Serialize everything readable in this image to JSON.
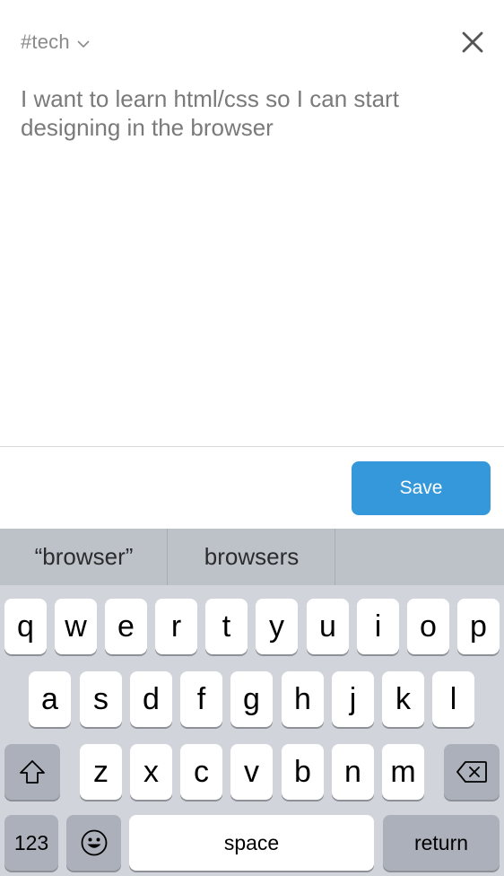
{
  "header": {
    "channel": "#tech",
    "chevron_icon": "chevron-down-icon",
    "close_icon": "close-icon"
  },
  "compose": {
    "text": "I want to learn html/css so I can start designing in the browser"
  },
  "actions": {
    "save_label": "Save",
    "save_color": "#3498db"
  },
  "suggestions": [
    "“browser”",
    "browsers",
    ""
  ],
  "keyboard": {
    "row1": [
      "q",
      "w",
      "e",
      "r",
      "t",
      "y",
      "u",
      "i",
      "o",
      "p"
    ],
    "row2": [
      "a",
      "s",
      "d",
      "f",
      "g",
      "h",
      "j",
      "k",
      "l"
    ],
    "row3": [
      "z",
      "x",
      "c",
      "v",
      "b",
      "n",
      "m"
    ],
    "shift_icon": "shift-icon",
    "delete_icon": "backspace-icon",
    "numbers_label": "123",
    "emoji_icon": "emoji-icon",
    "space_label": "space",
    "return_label": "return"
  }
}
